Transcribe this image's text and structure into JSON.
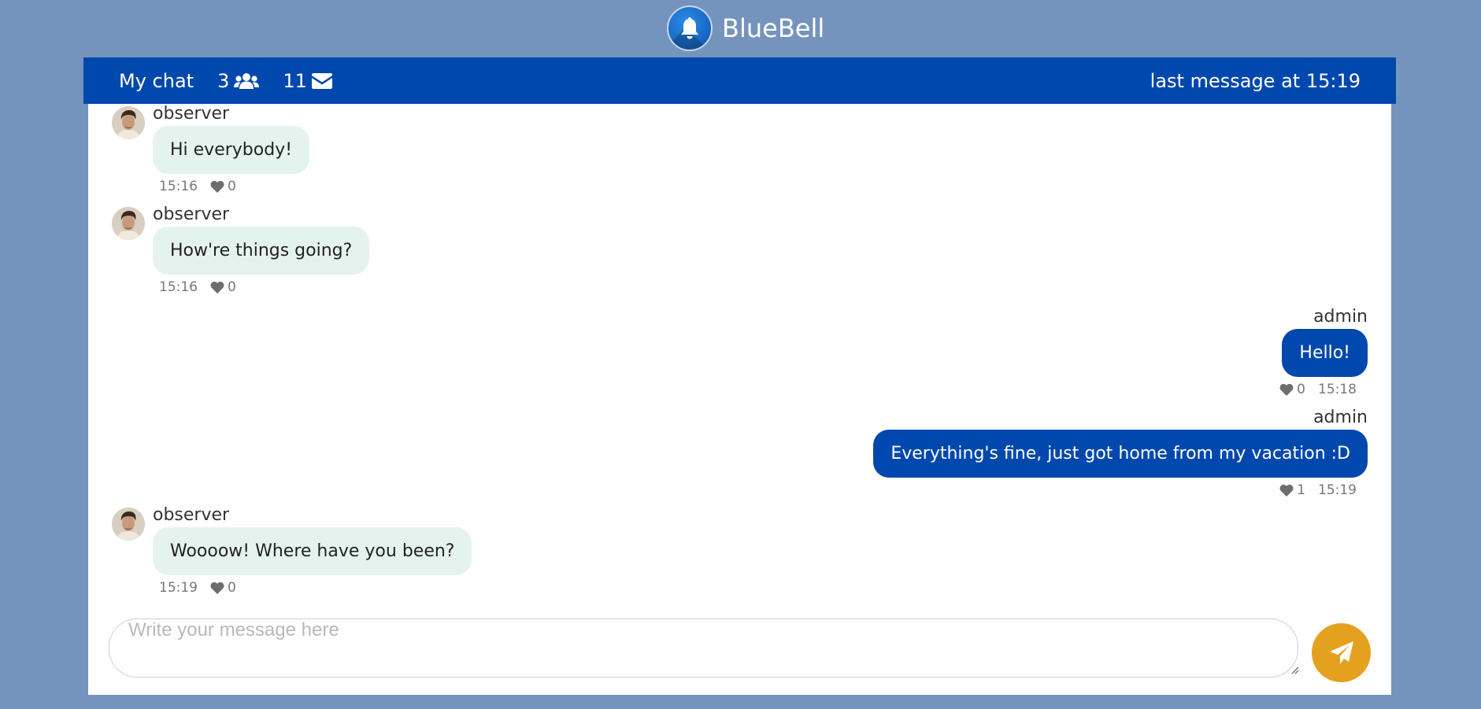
{
  "app": {
    "name": "BlueBell",
    "logo_icon": "bell-icon"
  },
  "header": {
    "title": "My chat",
    "users_count": "3",
    "users_icon": "users-icon",
    "messages_count": "11",
    "messages_icon": "envelope-icon",
    "last_message": "last message at 15:19",
    "background": "#0048ad"
  },
  "messages": [
    {
      "author": "observer",
      "side": "left",
      "text": "Hi everybody!",
      "time": "15:16",
      "likes": "0"
    },
    {
      "author": "observer",
      "side": "left",
      "text": "How're things going?",
      "time": "15:16",
      "likes": "0"
    },
    {
      "author": "admin",
      "side": "right",
      "text": "Hello!",
      "time": "15:18",
      "likes": "0"
    },
    {
      "author": "admin",
      "side": "right",
      "text": "Everything's fine, just got home from my vacation :D",
      "time": "15:19",
      "likes": "1"
    },
    {
      "author": "observer",
      "side": "left",
      "text": "Woooow! Where have you been?",
      "time": "15:19",
      "likes": "0"
    }
  ],
  "composer": {
    "placeholder": "Write your message here",
    "value": "",
    "send_icon": "paper-plane-icon"
  },
  "colors": {
    "page_background": "#7494bd",
    "incoming_bubble": "#e5f3ef",
    "outgoing_bubble": "#0048ad",
    "send_button": "#e4a120"
  }
}
